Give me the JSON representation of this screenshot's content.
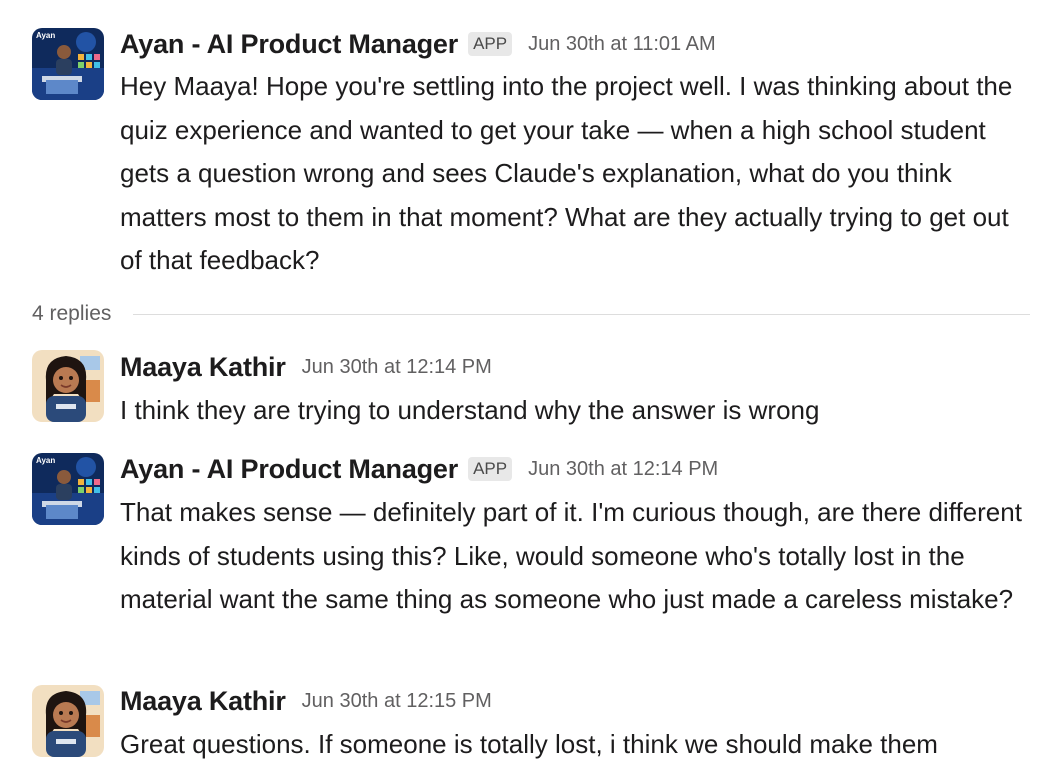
{
  "messages": [
    {
      "sender": "Ayan - AI Product Manager",
      "badge": "APP",
      "timestamp": "Jun 30th at 11:01 AM",
      "text": "Hey Maaya! Hope you're settling into the project well. I was thinking about the quiz experience and wanted to get your take — when a high school student gets a question wrong and sees Claude's explanation, what do you think matters most to them in that moment? What are they actually trying to get out of that feedback?",
      "avatar_label": "Ayan"
    },
    {
      "sender": "Maaya Kathir",
      "timestamp": "Jun 30th at 12:14 PM",
      "text": "I think they are trying to understand why the answer is wrong"
    },
    {
      "sender": "Ayan - AI Product Manager",
      "badge": "APP",
      "timestamp": "Jun 30th at 12:14 PM",
      "text": "That makes sense — definitely part of it. I'm curious though, are there different kinds of students using this? Like, would someone who's totally lost in the material want the same thing as someone who just made a careless mistake?",
      "avatar_label": "Ayan"
    },
    {
      "sender": "Maaya Kathir",
      "timestamp": "Jun 30th at 12:15 PM",
      "text": "Great questions. If someone is totally lost, i think we should make them"
    }
  ],
  "thread": {
    "replies_label": "4 replies"
  },
  "icons": {
    "ayan_avatar": "robot-pm-avatar-icon",
    "maaya_avatar": "maaya-avatar-icon"
  },
  "colors": {
    "text": "#1d1c1d",
    "muted": "#616061",
    "badge_bg": "#e8e8e8",
    "divider": "#dddddd"
  }
}
